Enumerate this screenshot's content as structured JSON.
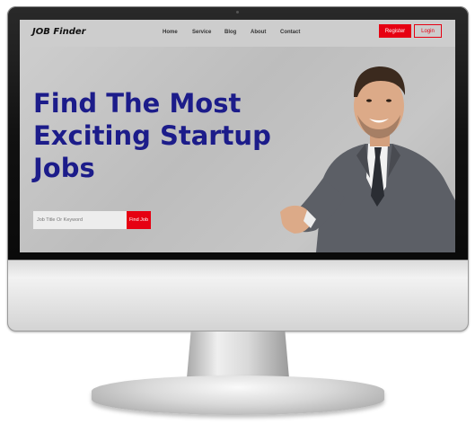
{
  "nav": {
    "logo": "JOB Finder",
    "links": [
      "Home",
      "Service",
      "Blog",
      "About",
      "Contact"
    ],
    "register_label": "Register",
    "login_label": "Login"
  },
  "hero": {
    "headline_line1": "Find The Most",
    "headline_line2": "Exciting Startup",
    "headline_line3": "Jobs",
    "search_placeholder": "Job Title Or Keyword",
    "search_button": "Find Job"
  },
  "colors": {
    "accent": "#e60012",
    "headline": "#1c1c8a"
  }
}
